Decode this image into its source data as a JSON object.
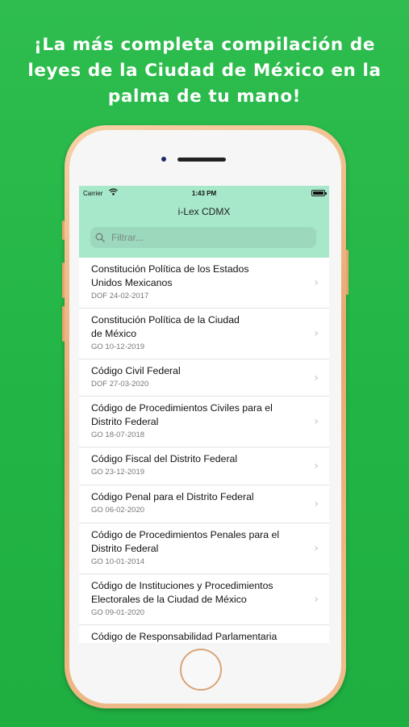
{
  "headline": {
    "lines": [
      "¡La más completa compilación de",
      "leyes de la Ciudad de México en la",
      "palma de tu mano!"
    ]
  },
  "status_bar": {
    "carrier": "Carrier",
    "time": "1:43 PM"
  },
  "nav": {
    "title": "i-Lex CDMX"
  },
  "search": {
    "placeholder": "Filtrar..."
  },
  "laws": [
    {
      "title_lines": [
        "Constitución Política de los Estados",
        "Unidos Mexicanos"
      ],
      "date": "DOF 24-02-2017"
    },
    {
      "title_lines": [
        "Constitución Política de la Ciudad",
        "de México"
      ],
      "date": "GO 10-12-2019"
    },
    {
      "title_lines": [
        "Código Civil Federal"
      ],
      "date": "DOF 27-03-2020"
    },
    {
      "title_lines": [
        "Código de Procedimientos Civiles para el",
        "Distrito Federal"
      ],
      "date": "GO 18-07-2018"
    },
    {
      "title_lines": [
        "Código Fiscal del Distrito Federal"
      ],
      "date": "GO 23-12-2019"
    },
    {
      "title_lines": [
        "Código Penal para el Distrito Federal"
      ],
      "date": "GO 06-02-2020"
    },
    {
      "title_lines": [
        "Código de Procedimientos Penales para el",
        "Distrito Federal"
      ],
      "date": "GO 10-01-2014"
    },
    {
      "title_lines": [
        "Código de Instituciones y Procedimientos",
        "Electorales de la Ciudad de México"
      ],
      "date": "GO 09-01-2020"
    },
    {
      "title_lines": [
        "Código de Responsabilidad Parlamentaria"
      ],
      "date": ""
    }
  ],
  "colors": {
    "background": "#22b545",
    "navbar": "#a6e8c9",
    "phone_frame": "#e8a873"
  },
  "icons": {
    "wifi": "wifi-icon",
    "battery": "battery-icon",
    "search": "search-icon",
    "chevron": "chevron-right-icon"
  }
}
